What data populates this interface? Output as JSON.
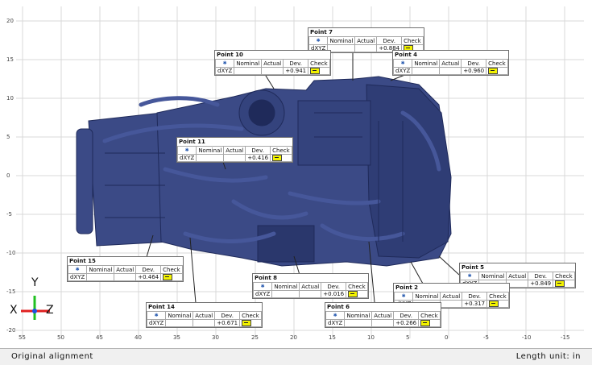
{
  "status": {
    "alignment_label": "Original alignment",
    "unit_label": "Length unit: in"
  },
  "axes": {
    "x_ticks": [
      "55",
      "50",
      "45",
      "40",
      "35",
      "30",
      "25",
      "20",
      "15",
      "10",
      "5",
      "0",
      "-5",
      "-10",
      "-15"
    ],
    "y_ticks": [
      "20",
      "15",
      "10",
      "5",
      "0",
      "-5",
      "-10",
      "-15",
      "-20"
    ]
  },
  "triad": {
    "y_label": "Y",
    "x_label": "X",
    "z_label": "Z"
  },
  "table_headers": {
    "nominal": "Nominal",
    "actual": "Actual",
    "dev": "Dev.",
    "check": "Check",
    "dxyz": "dXYZ"
  },
  "points": [
    {
      "id": "point-7",
      "name": "Point 7",
      "dev": "+0.884"
    },
    {
      "id": "point-10",
      "name": "Point 10",
      "dev": "+0.941"
    },
    {
      "id": "point-4",
      "name": "Point 4",
      "dev": "+0.960"
    },
    {
      "id": "point-11",
      "name": "Point 11",
      "dev": "+0.416"
    },
    {
      "id": "point-15",
      "name": "Point 15",
      "dev": "+0.464"
    },
    {
      "id": "point-5",
      "name": "Point 5",
      "dev": "+0.849"
    },
    {
      "id": "point-8",
      "name": "Point 8",
      "dev": "+0.016"
    },
    {
      "id": "point-2",
      "name": "Point 2",
      "dev": "+0.317"
    },
    {
      "id": "point-14",
      "name": "Point 14",
      "dev": "+0.671"
    },
    {
      "id": "point-6",
      "name": "Point 6",
      "dev": "+0.266"
    }
  ],
  "colors": {
    "part": "#3b4a86",
    "part_dark": "#1f2a5a",
    "grid": "#d8d8d8",
    "axis_x": "#e02020",
    "axis_y": "#20c020",
    "axis_z": "#2050e0",
    "check_ok": "#f2f200"
  }
}
